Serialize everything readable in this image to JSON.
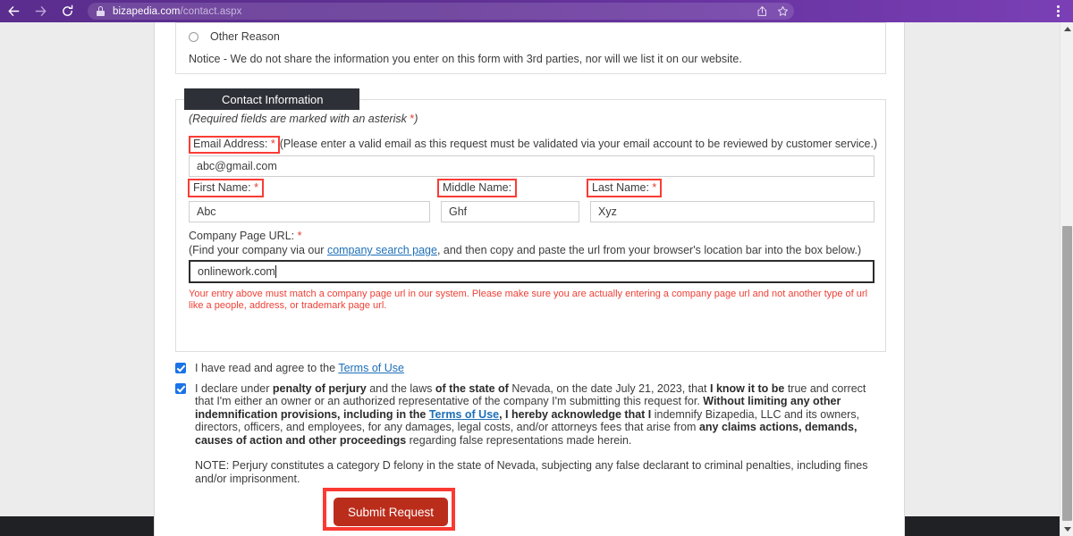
{
  "browser": {
    "back_icon": "back-arrow-icon",
    "forward_icon": "forward-arrow-icon",
    "reload_icon": "reload-icon",
    "lock_icon": "lock-icon",
    "url_host": "bizapedia.com",
    "url_path": "/contact.aspx",
    "share_icon": "share-icon",
    "bookmark_icon": "star-icon",
    "menu_icon": "kebab-menu-icon"
  },
  "form": {
    "other_reason_label": "Other Reason",
    "notice": "Notice - We do not share the information you enter on this form with 3rd parties, nor will we list it on our website.",
    "section_title": "Contact Information",
    "required_note": "(Required fields are marked with an asterisk ",
    "required_note_star": "*",
    "required_note_end": ")",
    "email": {
      "label": "Email Address: ",
      "star": "*",
      "hint": " (Please enter a valid email as this request must be validated via your email account to be reviewed by customer service.)",
      "value": "abc@gmail.com"
    },
    "first_name": {
      "label": "First Name: ",
      "star": "*",
      "value": "Abc"
    },
    "middle_name": {
      "label": "Middle Name:",
      "value": "Ghf"
    },
    "last_name": {
      "label": "Last Name: ",
      "star": "*",
      "value": "Xyz"
    },
    "company_url": {
      "label": "Company Page URL: ",
      "star": "*",
      "sub_prefix": "(Find your company via our ",
      "link_text": "company search page",
      "sub_suffix": ", and then copy and paste the url from your browser's location bar into the box below.)",
      "value": "onlinework.com",
      "error": "Your entry above must match a company page url in our system. Please make sure you are actually entering a company page url and not another type of url like a people, address, or trademark page url."
    }
  },
  "agreements": {
    "terms_checkbox": {
      "prefix": "I have read and agree to the ",
      "link_text": "Terms of Use"
    },
    "perjury_checkbox": {
      "p1": "I declare under ",
      "b1": "penalty of perjury",
      "p2": " and the laws ",
      "b2": "of the state of",
      "p3": " Nevada, on the date July 21, 2023, that ",
      "b3": "I know it to be",
      "p4": " true and correct that I'm either an owner or an authorized representative of the company I'm submitting this request for. ",
      "b4": "Without limiting any other indemnification provisions, including in the ",
      "link_text": "Terms of Use",
      "b5": ", I hereby acknowledge that I",
      "p5": " indemnify Bizapedia, LLC and its owners, directors, officers, and employees, for any damages, legal costs, and/or attorneys fees that arise from ",
      "b6": "any claims",
      "p6": " ",
      "b7": "actions, demands, causes of action and other proceedings",
      "p7": " regarding false representations made herein."
    },
    "note": "NOTE: Perjury constitutes a category D felony in the state of Nevada, subjecting any false declarant to criminal penalties, including fines and/or imprisonment."
  },
  "submit": {
    "label": "Submit Request"
  }
}
